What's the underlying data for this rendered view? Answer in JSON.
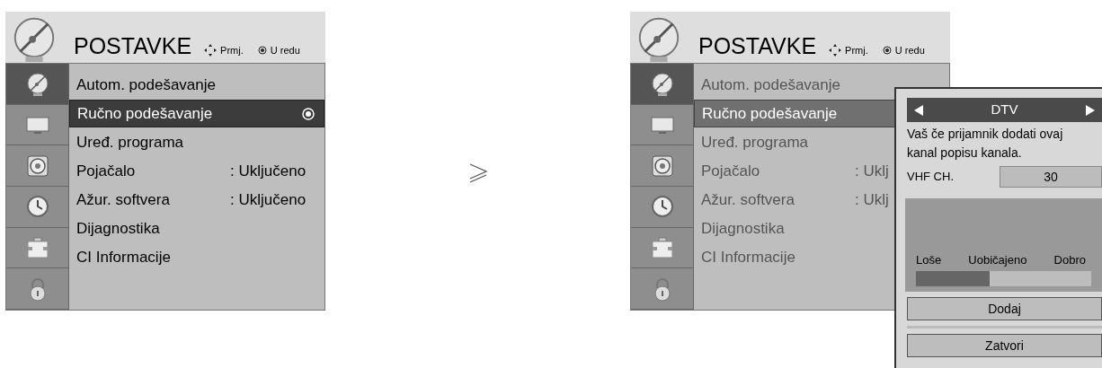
{
  "panels": [
    {
      "header": {
        "title": "POSTAVKE",
        "hints": [
          {
            "kind": "move",
            "label": "Prmj."
          },
          {
            "kind": "ok",
            "label": "U redu"
          }
        ]
      },
      "dimmed": false,
      "sidebar": [
        {
          "kind": "dish",
          "selected": true
        },
        {
          "kind": "tv",
          "selected": false
        },
        {
          "kind": "speaker",
          "selected": false
        },
        {
          "kind": "clock",
          "selected": false
        },
        {
          "kind": "card",
          "selected": false
        },
        {
          "kind": "lock",
          "selected": false
        }
      ],
      "items": [
        {
          "label": "Autom. podešavanje",
          "selected": false
        },
        {
          "label": "Ručno podešavanje",
          "selected": true,
          "ok_mark": true
        },
        {
          "label": "Uređ. programa",
          "selected": false
        },
        {
          "label": "Pojačalo",
          "value": ": Uključeno",
          "selected": false
        },
        {
          "label": "Ažur. softvera",
          "value": ": Uključeno",
          "selected": false
        },
        {
          "label": "Dijagnostika",
          "selected": false
        },
        {
          "label": "CI Informacije",
          "selected": false
        }
      ]
    },
    {
      "header": {
        "title": "POSTAVKE",
        "hints": [
          {
            "kind": "move",
            "label": "Prmj."
          },
          {
            "kind": "ok",
            "label": "U redu"
          }
        ]
      },
      "dimmed": true,
      "sidebar": [
        {
          "kind": "dish",
          "selected": true
        },
        {
          "kind": "tv",
          "selected": false
        },
        {
          "kind": "speaker",
          "selected": false
        },
        {
          "kind": "clock",
          "selected": false
        },
        {
          "kind": "card",
          "selected": false
        },
        {
          "kind": "lock",
          "selected": false
        }
      ],
      "items": [
        {
          "label": "Autom. podešavanje",
          "selected": false
        },
        {
          "label": "Ručno podešavanje",
          "selected": true
        },
        {
          "label": "Uređ. programa",
          "selected": false
        },
        {
          "label": "Pojačalo",
          "value": ": Uklj",
          "selected": false
        },
        {
          "label": "Ažur. softvera",
          "value": ": Uklj",
          "selected": false
        },
        {
          "label": "Dijagnostika",
          "selected": false
        },
        {
          "label": "CI Informacije",
          "selected": false
        }
      ]
    }
  ],
  "popup": {
    "source": "DTV",
    "message": "Vaš če prijamnik dodati ovaj kanal popisu kanala.",
    "channel_label": "VHF CH.",
    "channel_value": "30",
    "signal": {
      "labels": [
        "Loše",
        "Uobičajeno",
        "Dobro"
      ],
      "level": 0.42
    },
    "buttons": [
      "Dodaj",
      "Zatvori"
    ]
  }
}
